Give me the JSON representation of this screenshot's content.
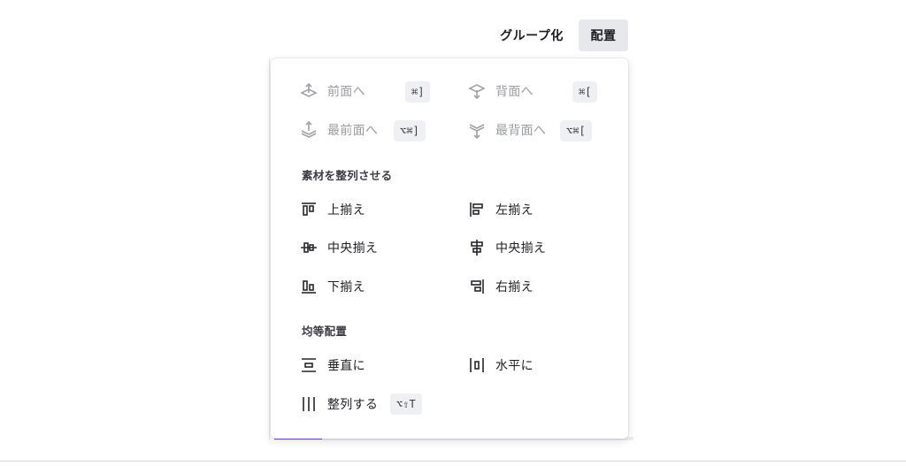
{
  "toolbar": {
    "group_label": "グループ化",
    "arrange_label": "配置"
  },
  "layer": {
    "forward": {
      "label": "前面へ",
      "shortcut": "⌘]",
      "icon": "bring-forward-icon"
    },
    "backward": {
      "label": "背面へ",
      "shortcut": "⌘[",
      "icon": "send-backward-icon"
    },
    "to_front": {
      "label": "最前面へ",
      "shortcut": "⌥⌘]",
      "icon": "bring-to-front-icon"
    },
    "to_back": {
      "label": "最背面へ",
      "shortcut": "⌥⌘[",
      "icon": "send-to-back-icon"
    }
  },
  "align": {
    "title": "素材を整列させる",
    "top": {
      "label": "上揃え",
      "icon": "align-top-icon"
    },
    "left": {
      "label": "左揃え",
      "icon": "align-left-icon"
    },
    "middle": {
      "label": "中央揃え",
      "icon": "align-middle-icon"
    },
    "center": {
      "label": "中央揃え",
      "icon": "align-center-icon"
    },
    "bottom": {
      "label": "下揃え",
      "icon": "align-bottom-icon"
    },
    "right": {
      "label": "右揃え",
      "icon": "align-right-icon"
    }
  },
  "distribute": {
    "title": "均等配置",
    "vertical": {
      "label": "垂直に",
      "icon": "distribute-vertical-icon"
    },
    "horizontal": {
      "label": "水平に",
      "icon": "distribute-horizontal-icon"
    },
    "tidy": {
      "label": "整列する",
      "shortcut": "⌥⇧T",
      "icon": "tidy-up-icon"
    }
  },
  "colors": {
    "accent": "#8b3dff",
    "button_bg": "#e7e8ec",
    "disabled_text": "#9a9ca2"
  }
}
